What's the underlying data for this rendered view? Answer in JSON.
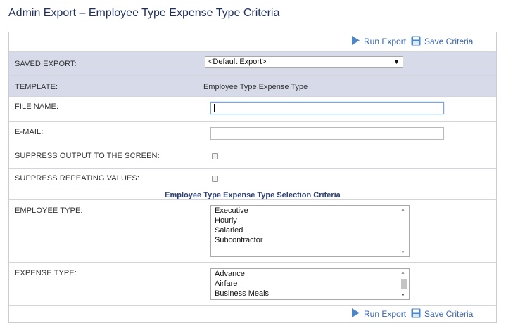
{
  "page": {
    "title": "Admin Export – Employee Type Expense Type Criteria"
  },
  "toolbar": {
    "run_label": "Run Export",
    "save_label": "Save Criteria"
  },
  "form": {
    "saved_export": {
      "label": "SAVED EXPORT:",
      "value": "<Default Export>"
    },
    "template": {
      "label": "TEMPLATE:",
      "value": "Employee Type Expense Type"
    },
    "file_name": {
      "label": "FILE NAME:",
      "value": ""
    },
    "email": {
      "label": "E-MAIL:",
      "value": ""
    },
    "suppress_output": {
      "label": "SUPPRESS OUTPUT TO THE SCREEN:",
      "checked": false
    },
    "suppress_repeating": {
      "label": "SUPPRESS REPEATING VALUES:",
      "checked": false
    }
  },
  "criteria": {
    "header": "Employee Type Expense Type Selection Criteria",
    "employee_type": {
      "label": "EMPLOYEE TYPE:",
      "options": [
        "Executive",
        "Hourly",
        "Salaried",
        "Subcontractor"
      ]
    },
    "expense_type": {
      "label": "EXPENSE TYPE:",
      "options": [
        "Advance",
        "Airfare",
        "Business Meals"
      ]
    }
  },
  "colors": {
    "accent": "#3a64b1",
    "shaded_row": "#d6dae9",
    "title": "#1f2f5f"
  },
  "icons": {
    "run": "play-triangle-icon",
    "save": "floppy-disk-icon"
  }
}
